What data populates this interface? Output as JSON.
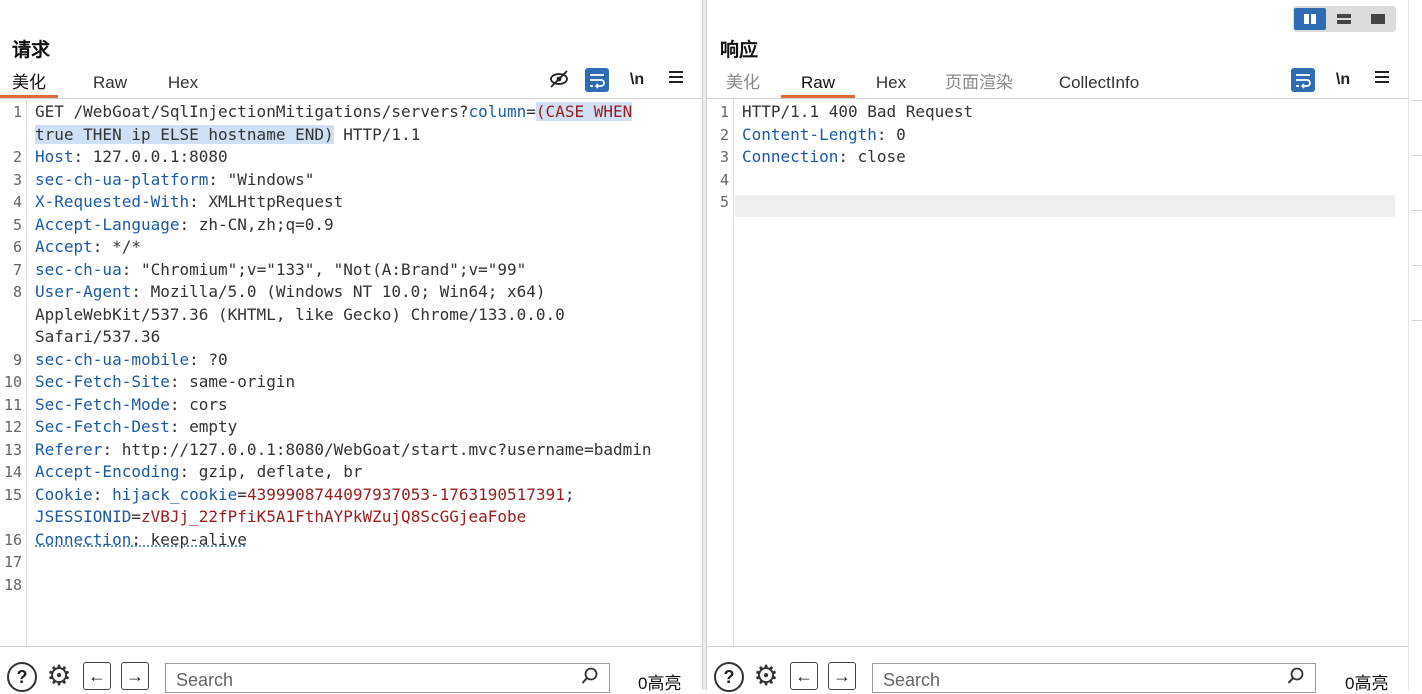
{
  "request": {
    "title": "请求",
    "tabs": [
      {
        "label": "美化",
        "active": true
      },
      {
        "label": "Raw",
        "active": false
      },
      {
        "label": "Hex",
        "active": false
      }
    ],
    "tools": [
      "eye-slash-icon",
      "word-wrap-icon",
      "newline-toggle",
      "menu-icon"
    ],
    "newline_label": "\\n",
    "lines": [
      {
        "n": "1",
        "parts": [
          {
            "t": "GET /WebGoat/SqlInjectionMitigations/servers?",
            "c": "v"
          },
          {
            "t": "column",
            "c": "k"
          },
          {
            "t": "=",
            "c": "v"
          },
          {
            "t": "(CASE WHEN",
            "c": "red hl"
          }
        ]
      },
      {
        "n": "",
        "parts": [
          {
            "t": "true THEN ip ELSE hostname END)",
            "c": "v hl"
          },
          {
            "t": " HTTP/1.1",
            "c": "v"
          }
        ]
      },
      {
        "n": "2",
        "parts": [
          {
            "t": "Host",
            "c": "k"
          },
          {
            "t": ": 127.0.0.1:8080",
            "c": "v"
          }
        ]
      },
      {
        "n": "3",
        "parts": [
          {
            "t": "sec-ch-ua-platform",
            "c": "k"
          },
          {
            "t": ": \"Windows\"",
            "c": "v"
          }
        ]
      },
      {
        "n": "4",
        "parts": [
          {
            "t": "X-Requested-With",
            "c": "k"
          },
          {
            "t": ": XMLHttpRequest",
            "c": "v"
          }
        ]
      },
      {
        "n": "5",
        "parts": [
          {
            "t": "Accept-Language",
            "c": "k"
          },
          {
            "t": ": zh-CN,zh;q=0.9",
            "c": "v"
          }
        ]
      },
      {
        "n": "6",
        "parts": [
          {
            "t": "Accept",
            "c": "k"
          },
          {
            "t": ": */*",
            "c": "v"
          }
        ]
      },
      {
        "n": "7",
        "parts": [
          {
            "t": "sec-ch-ua",
            "c": "k"
          },
          {
            "t": ": \"Chromium\";v=\"133\", \"Not(A:Brand\";v=\"99\"",
            "c": "v"
          }
        ]
      },
      {
        "n": "8",
        "parts": [
          {
            "t": "User-Agent",
            "c": "k"
          },
          {
            "t": ": Mozilla/5.0 (Windows NT 10.0; Win64; x64)",
            "c": "v"
          }
        ]
      },
      {
        "n": "",
        "parts": [
          {
            "t": "AppleWebKit/537.36 (KHTML, like Gecko) Chrome/133.0.0.0",
            "c": "v"
          }
        ]
      },
      {
        "n": "",
        "parts": [
          {
            "t": "Safari/537.36",
            "c": "v"
          }
        ]
      },
      {
        "n": "9",
        "parts": [
          {
            "t": "sec-ch-ua-mobile",
            "c": "k"
          },
          {
            "t": ": ?0",
            "c": "v"
          }
        ]
      },
      {
        "n": "10",
        "parts": [
          {
            "t": "Sec-Fetch-Site",
            "c": "k"
          },
          {
            "t": ": same-origin",
            "c": "v"
          }
        ]
      },
      {
        "n": "11",
        "parts": [
          {
            "t": "Sec-Fetch-Mode",
            "c": "k"
          },
          {
            "t": ": cors",
            "c": "v"
          }
        ]
      },
      {
        "n": "12",
        "parts": [
          {
            "t": "Sec-Fetch-Dest",
            "c": "k"
          },
          {
            "t": ": empty",
            "c": "v"
          }
        ]
      },
      {
        "n": "13",
        "parts": [
          {
            "t": "Referer",
            "c": "k"
          },
          {
            "t": ": http://127.0.0.1:8080/WebGoat/start.mvc?username=badmin",
            "c": "v"
          }
        ]
      },
      {
        "n": "14",
        "parts": [
          {
            "t": "Accept-Encoding",
            "c": "k"
          },
          {
            "t": ": gzip, deflate, br",
            "c": "v"
          }
        ]
      },
      {
        "n": "15",
        "parts": [
          {
            "t": "Cookie",
            "c": "k"
          },
          {
            "t": ": ",
            "c": "v"
          },
          {
            "t": "hijack_cookie",
            "c": "k"
          },
          {
            "t": "=",
            "c": "v"
          },
          {
            "t": "4399908744097937053-1763190517391",
            "c": "red"
          },
          {
            "t": ";",
            "c": "v"
          }
        ]
      },
      {
        "n": "",
        "parts": [
          {
            "t": "JSESSIONID",
            "c": "k"
          },
          {
            "t": "=",
            "c": "v"
          },
          {
            "t": "zVBJj_22fPfiK5A1FthAYPkWZujQ8ScGGjeaFobe",
            "c": "red"
          }
        ]
      },
      {
        "n": "16",
        "parts": [
          {
            "t": "Connection",
            "c": "k u"
          },
          {
            "t": ": keep-alive",
            "c": "v u"
          }
        ]
      },
      {
        "n": "17",
        "parts": []
      },
      {
        "n": "18",
        "parts": []
      }
    ],
    "footer": {
      "search_placeholder": "Search",
      "highlight_count": "0高亮"
    }
  },
  "response": {
    "title": "响应",
    "tabs": [
      {
        "label": "美化",
        "active": false,
        "muted": true
      },
      {
        "label": "Raw",
        "active": true
      },
      {
        "label": "Hex",
        "active": false
      },
      {
        "label": "页面渲染",
        "active": false,
        "muted": true
      },
      {
        "label": "CollectInfo",
        "active": false
      }
    ],
    "newline_label": "\\n",
    "lines": [
      {
        "n": "1",
        "parts": [
          {
            "t": "HTTP/1.1 400 Bad Request",
            "c": "v"
          }
        ]
      },
      {
        "n": "2",
        "parts": [
          {
            "t": "Content-Length",
            "c": "k"
          },
          {
            "t": ": 0",
            "c": "v"
          }
        ]
      },
      {
        "n": "3",
        "parts": [
          {
            "t": "Connection",
            "c": "k"
          },
          {
            "t": ": close",
            "c": "v"
          }
        ]
      },
      {
        "n": "4",
        "parts": []
      },
      {
        "n": "5",
        "parts": []
      }
    ],
    "footer": {
      "search_placeholder": "Search",
      "highlight_count": "0高亮"
    }
  },
  "layout_toggle": {
    "options": [
      "side-by-side",
      "stacked-horizontal",
      "single-pane"
    ],
    "selected": "side-by-side"
  },
  "colors": {
    "accent": "#2e6db4",
    "tab_underline": "#e06a3a",
    "header_key": "#1c5aa6",
    "value_red": "#9b1c1c",
    "selection": "#cfe0f5"
  }
}
